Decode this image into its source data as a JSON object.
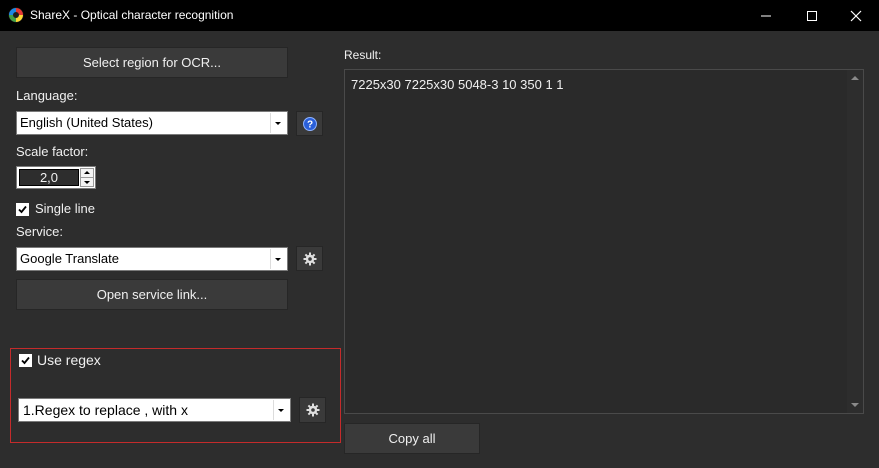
{
  "window": {
    "title": "ShareX - Optical character recognition"
  },
  "left": {
    "select_region_button": "Select region for OCR...",
    "language_label": "Language:",
    "language_value": "English (United States)",
    "scale_label": "Scale factor:",
    "scale_value": "2,0",
    "single_line_label": "Single line",
    "single_line_checked": true,
    "service_label": "Service:",
    "service_value": "Google Translate",
    "open_service_button": "Open service link..."
  },
  "regex": {
    "use_regex_label": "Use regex",
    "use_regex_checked": true,
    "regex_value": "1.Regex to replace , with x"
  },
  "result": {
    "label": "Result:",
    "text": "7225x30 7225x30 5048-3 10 350 1 1",
    "copy_all_button": "Copy all"
  },
  "colors": {
    "background": "#2d2d2d",
    "titlebar": "#000000",
    "regex_border": "#c42b2b",
    "help_icon": "#2a5fd8"
  },
  "icons": {
    "app": "sharex-logo-icon",
    "minimize": "minimize-icon",
    "maximize": "maximize-icon",
    "close": "close-icon",
    "help": "help-icon",
    "service_settings": "gear-icon",
    "regex_settings": "gear-icon"
  }
}
